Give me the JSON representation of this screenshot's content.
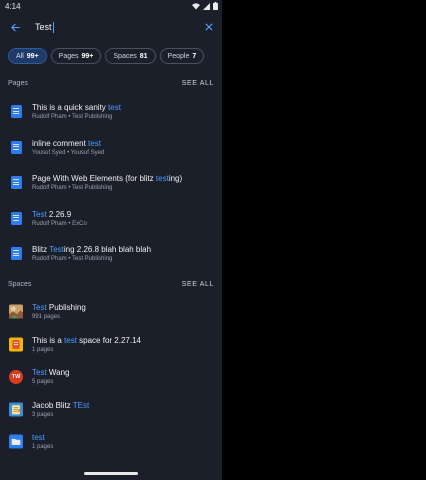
{
  "status_bar": {
    "time": "4:14"
  },
  "search": {
    "query": "Test"
  },
  "filters": [
    {
      "label": "All",
      "count": "99+",
      "active": true
    },
    {
      "label": "Pages",
      "count": "99+",
      "active": false
    },
    {
      "label": "Spaces",
      "count": "81",
      "active": false
    },
    {
      "label": "People",
      "count": "7",
      "active": false
    }
  ],
  "pages_section": {
    "title": "Pages",
    "see_all": "SEE ALL",
    "items": [
      {
        "title_before": "This is a quick sanity ",
        "title_match": "test",
        "title_after": "",
        "subtitle": "Rudolf Pham • Test Publishing",
        "icon": "document-icon"
      },
      {
        "title_before": "inline comment ",
        "title_match": "test",
        "title_after": "",
        "subtitle": "Yousuf Syed • Yousuf Syed",
        "icon": "document-icon"
      },
      {
        "title_before": "Page With Web Elements (for blitz ",
        "title_match": "test",
        "title_after": "ing)",
        "subtitle": "Rudolf Pham • Test Publishing",
        "icon": "document-icon"
      },
      {
        "title_before": "",
        "title_match": "Test",
        "title_after": " 2.26.9",
        "subtitle": "Rudolf Pham • ExCo",
        "icon": "document-icon"
      },
      {
        "title_before": "Blitz ",
        "title_match": "Test",
        "title_after": "ing 2.26.8 blah blah blah",
        "subtitle": "Rudolf Pham • Test Publishing",
        "icon": "document-icon"
      }
    ]
  },
  "spaces_section": {
    "title": "Spaces",
    "see_all": "SEE ALL",
    "items": [
      {
        "title_before": "",
        "title_match": "Test",
        "title_after": " Publishing",
        "subtitle": "991 pages",
        "icon": "space-photo-icon"
      },
      {
        "title_before": "This is a ",
        "title_match": "test",
        "title_after": " space for 2.27.14",
        "subtitle": "1 pages",
        "icon": "space-book-icon"
      },
      {
        "title_before": "",
        "title_match": "Test",
        "title_after": " Wang",
        "subtitle": "5 pages",
        "icon": "avatar-tw",
        "avatar_initials": "TW"
      },
      {
        "title_before": "Jacob Blitz ",
        "title_match": "TEst",
        "title_after": "",
        "subtitle": "3 pages",
        "icon": "space-notes-icon"
      },
      {
        "title_before": "",
        "title_match": "test",
        "title_after": "",
        "subtitle": "1 pages",
        "icon": "space-folder-icon"
      }
    ]
  },
  "colors": {
    "background": "#1b1f2a",
    "accent": "#4b9cff",
    "active_chip": "#1f3a66",
    "doc_icon": "#2f7bf0",
    "avatar": "#d93c1e"
  }
}
